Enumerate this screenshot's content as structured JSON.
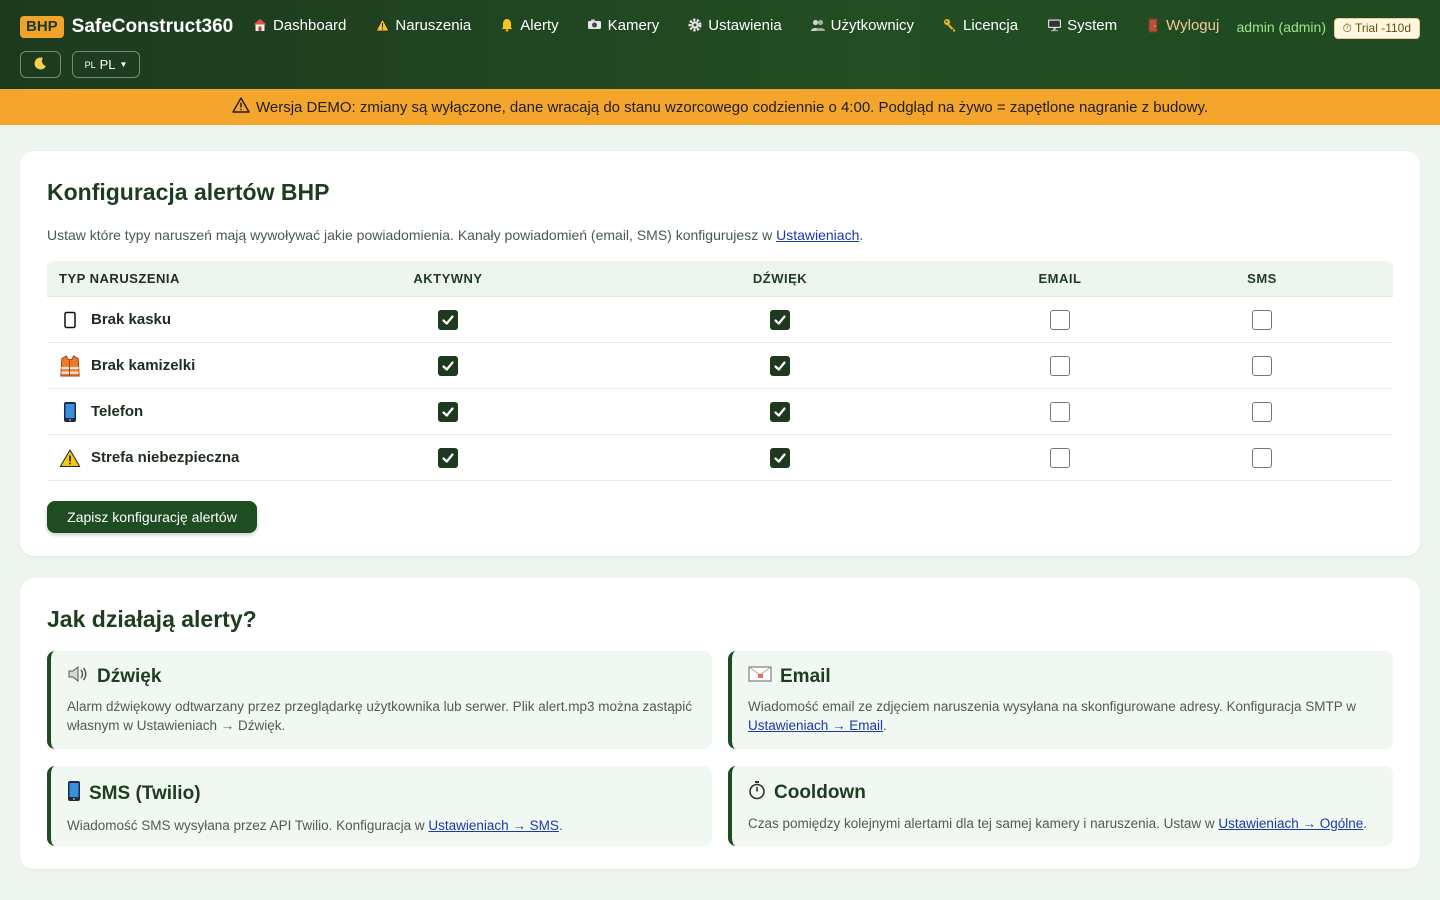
{
  "header": {
    "brand_badge": "BHP",
    "brand_name": "SafeConstruct360",
    "nav": [
      {
        "label": "Dashboard",
        "icon": "home-icon"
      },
      {
        "label": "Naruszenia",
        "icon": "warning-icon"
      },
      {
        "label": "Alerty",
        "icon": "bell-icon"
      },
      {
        "label": "Kamery",
        "icon": "camera-icon"
      },
      {
        "label": "Ustawienia",
        "icon": "gear-icon"
      },
      {
        "label": "Użytkownicy",
        "icon": "users-icon"
      },
      {
        "label": "Licencja",
        "icon": "key-icon"
      },
      {
        "label": "System",
        "icon": "monitor-icon"
      },
      {
        "label": "Wyloguj",
        "icon": "door-icon"
      }
    ],
    "user": "admin (admin)",
    "trial": "⏱ Trial -110d",
    "lang_small": "PL",
    "lang": "PL"
  },
  "banner": {
    "text": "Wersja DEMO: zmiany są wyłączone, dane wracają do stanu wzorcowego codziennie o 4:00. Podgląd na żywo = zapętlone nagranie z budowy."
  },
  "alerts_config": {
    "title": "Konfiguracja alertów BHP",
    "desc_pre": "Ustaw które typy naruszeń mają wywoływać jakie powiadomienia. Kanały powiadomień (email, SMS) konfigurujesz w ",
    "desc_link": "Ustawieniach",
    "desc_post": ".",
    "columns": [
      "TYP NARUSZENIA",
      "AKTYWNY",
      "DŹWIĘK",
      "EMAIL",
      "SMS"
    ],
    "rows": [
      {
        "label": "Brak kasku",
        "icon": "helmet-icon",
        "active": true,
        "sound": true,
        "email": false,
        "sms": false
      },
      {
        "label": "Brak kamizelki",
        "icon": "vest-icon",
        "active": true,
        "sound": true,
        "email": false,
        "sms": false
      },
      {
        "label": "Telefon",
        "icon": "phone-icon",
        "active": true,
        "sound": true,
        "email": false,
        "sms": false
      },
      {
        "label": "Strefa niebezpieczna",
        "icon": "warning-icon",
        "active": true,
        "sound": true,
        "email": false,
        "sms": false
      }
    ],
    "save_label": "Zapisz konfigurację alertów"
  },
  "how_it_works": {
    "title": "Jak działają alerty?",
    "boxes": [
      {
        "title": "Dźwięk",
        "icon": "speaker-icon",
        "text": "Alarm dźwiękowy odtwarzany przez przeglądarkę użytkownika lub serwer. Plik alert.mp3 można zastąpić własnym w Ustawieniach → Dźwięk.",
        "link": "",
        "post": ""
      },
      {
        "title": "Email",
        "icon": "envelope-icon",
        "text": "Wiadomość email ze zdjęciem naruszenia wysyłana na skonfigurowane adresy. Konfiguracja SMTP w ",
        "link": "Ustawieniach → Email",
        "post": "."
      },
      {
        "title": "SMS (Twilio)",
        "icon": "phone-icon",
        "text": "Wiadomość SMS wysyłana przez API Twilio. Konfiguracja w ",
        "link": "Ustawieniach → SMS",
        "post": "."
      },
      {
        "title": "Cooldown",
        "icon": "stopwatch-icon",
        "text": "Czas pomiędzy kolejnymi alertami dla tej samej kamery i naruszenia. Ustaw w ",
        "link": "Ustawieniach → Ogólne",
        "post": "."
      }
    ]
  }
}
